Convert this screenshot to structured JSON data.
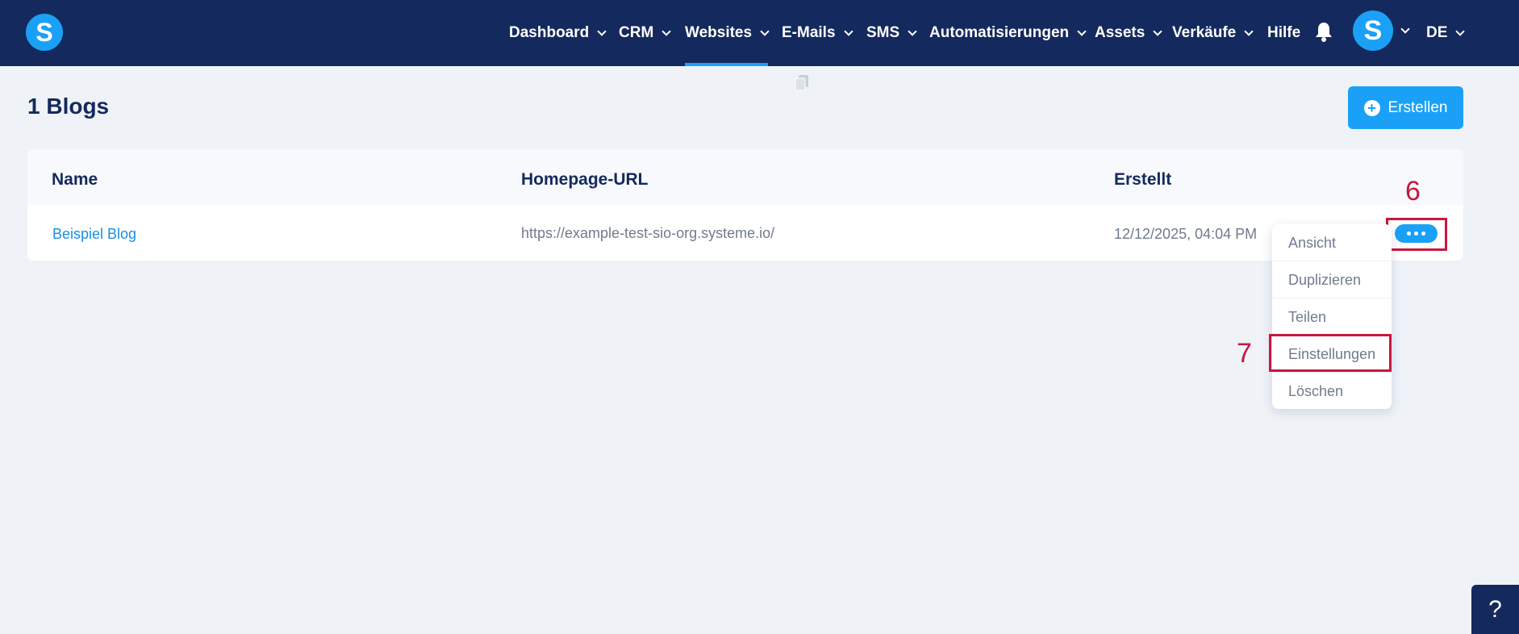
{
  "nav": {
    "items": [
      {
        "label": "Dashboard"
      },
      {
        "label": "CRM"
      },
      {
        "label": "Websites"
      },
      {
        "label": "E-Mails"
      },
      {
        "label": "SMS"
      },
      {
        "label": "Automatisierungen"
      },
      {
        "label": "Assets"
      },
      {
        "label": "Verkäufe"
      },
      {
        "label": "Hilfe"
      }
    ],
    "active": "Websites",
    "language": "DE",
    "logo_letter": "S",
    "avatar_letter": "S"
  },
  "page": {
    "title": "1 Blogs",
    "create_label": "Erstellen"
  },
  "table": {
    "headers": {
      "name": "Name",
      "url": "Homepage-URL",
      "created": "Erstellt"
    },
    "rows": [
      {
        "name": "Beispiel Blog",
        "url": "https://example-test-sio-org.systeme.io/",
        "created": "12/12/2025, 04:04 PM"
      }
    ]
  },
  "menu": {
    "items": [
      "Ansicht",
      "Duplizieren",
      "Teilen",
      "Einstellungen",
      "Löschen"
    ]
  },
  "annotations": {
    "step6": "6",
    "step7": "7"
  },
  "help": {
    "label": "?"
  },
  "colors": {
    "navy": "#14295d",
    "accent": "#1aa1f7",
    "highlight": "#c8173e"
  }
}
